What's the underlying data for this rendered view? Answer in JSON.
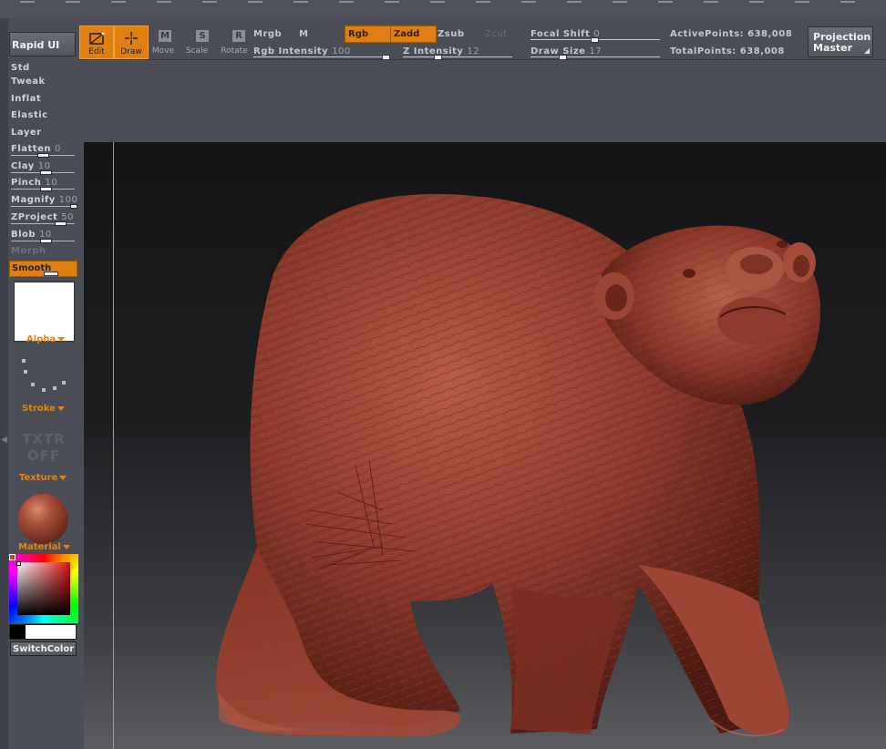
{
  "toolbar": {
    "rapid_ui": "Rapid UI",
    "edit": "Edit",
    "draw": "Draw",
    "move": "Move",
    "scale": "Scale",
    "rotate": "Rotate",
    "move_icon": "M",
    "scale_icon": "S",
    "rotate_icon": "R",
    "mrgb": "Mrgb",
    "m": "M",
    "rgb": "Rgb",
    "zadd": "Zadd",
    "zsub": "Zsub",
    "zcut": "Zcut",
    "rgb_intensity_label": "Rgb  Intensity",
    "rgb_intensity_value": "100",
    "z_intensity_label": "Z  Intensity",
    "z_intensity_value": "12",
    "focal_shift_label": "Focal  Shift",
    "focal_shift_value": "0",
    "draw_size_label": "Draw  Size",
    "draw_size_value": "17",
    "active_points": "ActivePoints: 638,008",
    "total_points": "TotalPoints: 638,008",
    "projection_master_line1": "Projection",
    "projection_master_line2": "Master"
  },
  "brushes": [
    {
      "name": "Std",
      "value": ""
    },
    {
      "name": "Tweak",
      "value": ""
    },
    {
      "name": "Inflat",
      "value": ""
    },
    {
      "name": "Elastic",
      "value": ""
    },
    {
      "name": "Layer",
      "value": ""
    },
    {
      "name": "Flatten",
      "value": "0"
    },
    {
      "name": "Clay",
      "value": "10"
    },
    {
      "name": "Pinch",
      "value": "10"
    },
    {
      "name": "Magnify",
      "value": "100"
    },
    {
      "name": "ZProject",
      "value": "50"
    },
    {
      "name": "Blob",
      "value": "10"
    },
    {
      "name": "Morph",
      "value": ""
    },
    {
      "name": "Smooth",
      "value": ""
    }
  ],
  "left": {
    "alpha": "Alpha",
    "stroke": "Stroke",
    "txtr_line1": "TXTR",
    "txtr_line2": "OFF",
    "texture": "Texture",
    "material": "Material",
    "switch_color": "SwitchColor"
  },
  "colors": {
    "accent": "#e07e10",
    "model": "#8e3a2c",
    "panel": "#4a4d55"
  }
}
